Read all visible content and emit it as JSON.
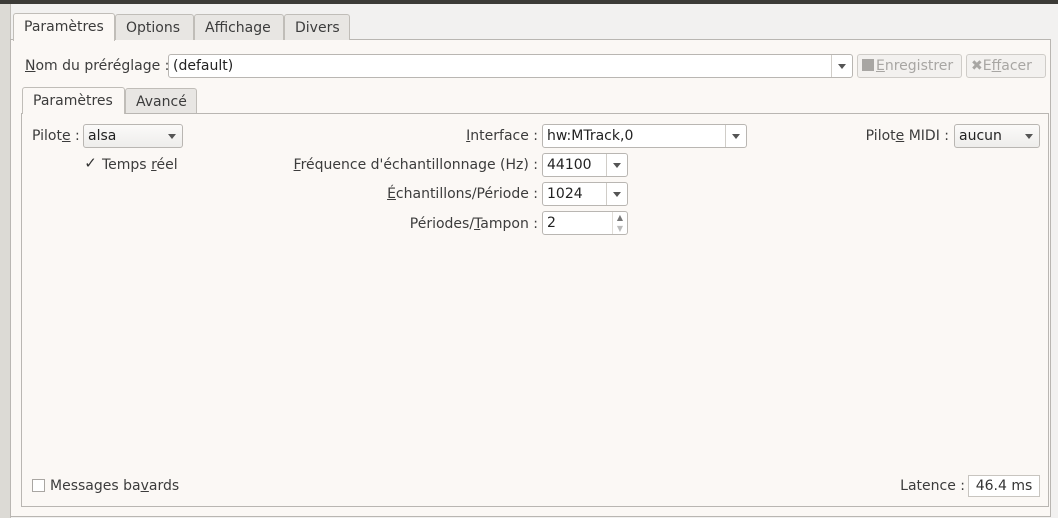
{
  "outer_tabs": [
    "Paramètres",
    "Options",
    "Affichage",
    "Divers"
  ],
  "preset": {
    "label": [
      "",
      "N",
      "om du préréglage :"
    ],
    "value": "(default)",
    "save": [
      "",
      "E",
      "nregistrer"
    ],
    "clear": [
      "E",
      "f",
      "facer"
    ]
  },
  "inner_tabs": [
    "Paramètres",
    "Avancé"
  ],
  "driver": {
    "label": [
      "Pilot",
      "e",
      " :"
    ],
    "value": "alsa"
  },
  "realtime": {
    "label": [
      "Temps ",
      "r",
      "éel"
    ],
    "checked": true,
    "mark": "✓"
  },
  "interface": {
    "label": [
      "",
      "I",
      "nterface :"
    ],
    "value": "hw:MTrack,0"
  },
  "samplerate": {
    "label": [
      "",
      "F",
      "réquence d'échantillonnage (Hz) :"
    ],
    "value": "44100"
  },
  "frames": {
    "label": [
      "",
      "É",
      "chantillons/Période :"
    ],
    "value": "1024"
  },
  "periods": {
    "label": [
      "Périodes/",
      "T",
      "ampon :"
    ],
    "value": "2"
  },
  "midi": {
    "label": [
      "Pilot",
      "e",
      " MIDI :"
    ],
    "value": "aucun"
  },
  "verbose": {
    "label": [
      "Messages ba",
      "v",
      "ards"
    ],
    "checked": false
  },
  "latency": {
    "label": "Latence :",
    "value": "46.4 ms"
  }
}
